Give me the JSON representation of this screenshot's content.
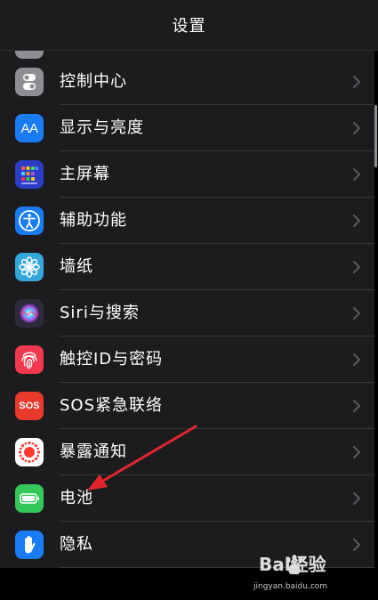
{
  "header": {
    "title": "设置"
  },
  "settings": {
    "items": [
      {
        "label": "控制中心",
        "icon": "control-center-icon",
        "color": "#8e8e93"
      },
      {
        "label": "显示与亮度",
        "icon": "display-brightness-icon",
        "color": "#1a7cf5",
        "glyph": "AA"
      },
      {
        "label": "主屏幕",
        "icon": "home-screen-icon",
        "color": "#2c3ec7"
      },
      {
        "label": "辅助功能",
        "icon": "accessibility-icon",
        "color": "#1a7cf5"
      },
      {
        "label": "墙纸",
        "icon": "wallpaper-icon",
        "color": "#35a7dc"
      },
      {
        "label": "Siri与搜索",
        "icon": "siri-icon",
        "color": "#2b2b3a"
      },
      {
        "label": "触控ID与密码",
        "icon": "touch-id-icon",
        "color": "#f0384f"
      },
      {
        "label": "SOS紧急联络",
        "icon": "sos-icon",
        "color": "#e8392b",
        "glyph": "SOS"
      },
      {
        "label": "暴露通知",
        "icon": "exposure-notification-icon",
        "color": "#ffffff"
      },
      {
        "label": "电池",
        "icon": "battery-icon",
        "color": "#34c759"
      },
      {
        "label": "隐私",
        "icon": "privacy-hand-icon",
        "color": "#1a7cf5"
      }
    ]
  },
  "annotation": {
    "color": "#e0262c"
  },
  "watermark": {
    "brand": "Bai经验",
    "url": "jingyan.baidu.com"
  }
}
